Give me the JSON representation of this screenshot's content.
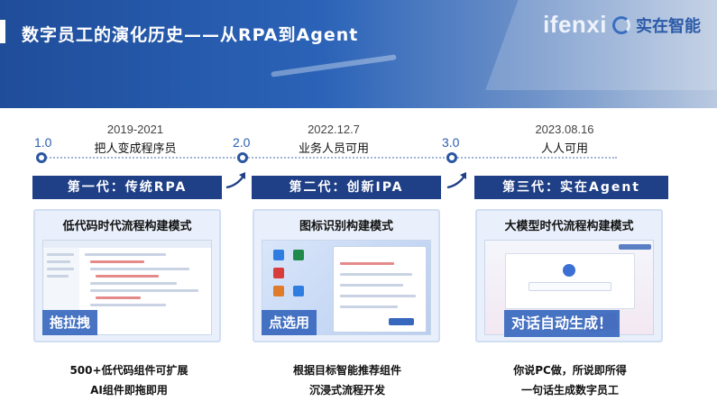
{
  "header": {
    "title": "数字员工的演化历史——从RPA到Agent",
    "logo_text": "ifenxi",
    "logo_partner": "实在智能"
  },
  "timeline": [
    {
      "version": "1.0",
      "date": "2019-2021",
      "subtitle": "把人变成程序员"
    },
    {
      "version": "2.0",
      "date": "2022.12.7",
      "subtitle": "业务人员可用"
    },
    {
      "version": "3.0",
      "date": "2023.08.16",
      "subtitle": "人人可用"
    }
  ],
  "generations": [
    {
      "label": "第一代：传统RPA",
      "card_title": "低代码时代流程构建模式",
      "tag": "拖拉拽",
      "bottom_lines": [
        "500+低代码组件可扩展",
        "AI组件即拖即用"
      ]
    },
    {
      "label": "第二代：创新IPA",
      "card_title": "图标识别构建模式",
      "tag": "点选用",
      "bottom_lines": [
        "根据目标智能推荐组件",
        "沉浸式流程开发"
      ]
    },
    {
      "label": "第三代：实在Agent",
      "card_title": "大模型时代流程构建模式",
      "tag": "对话自动生成！",
      "bottom_lines": [
        "你说PC做，所说即所得",
        "一句话生成数字员工"
      ]
    }
  ],
  "colors": {
    "header_blue": "#2b63b8",
    "gen_navy": "#1f3f86",
    "tag_blue": "#3868be",
    "timeline_blue": "#2a57a0"
  }
}
